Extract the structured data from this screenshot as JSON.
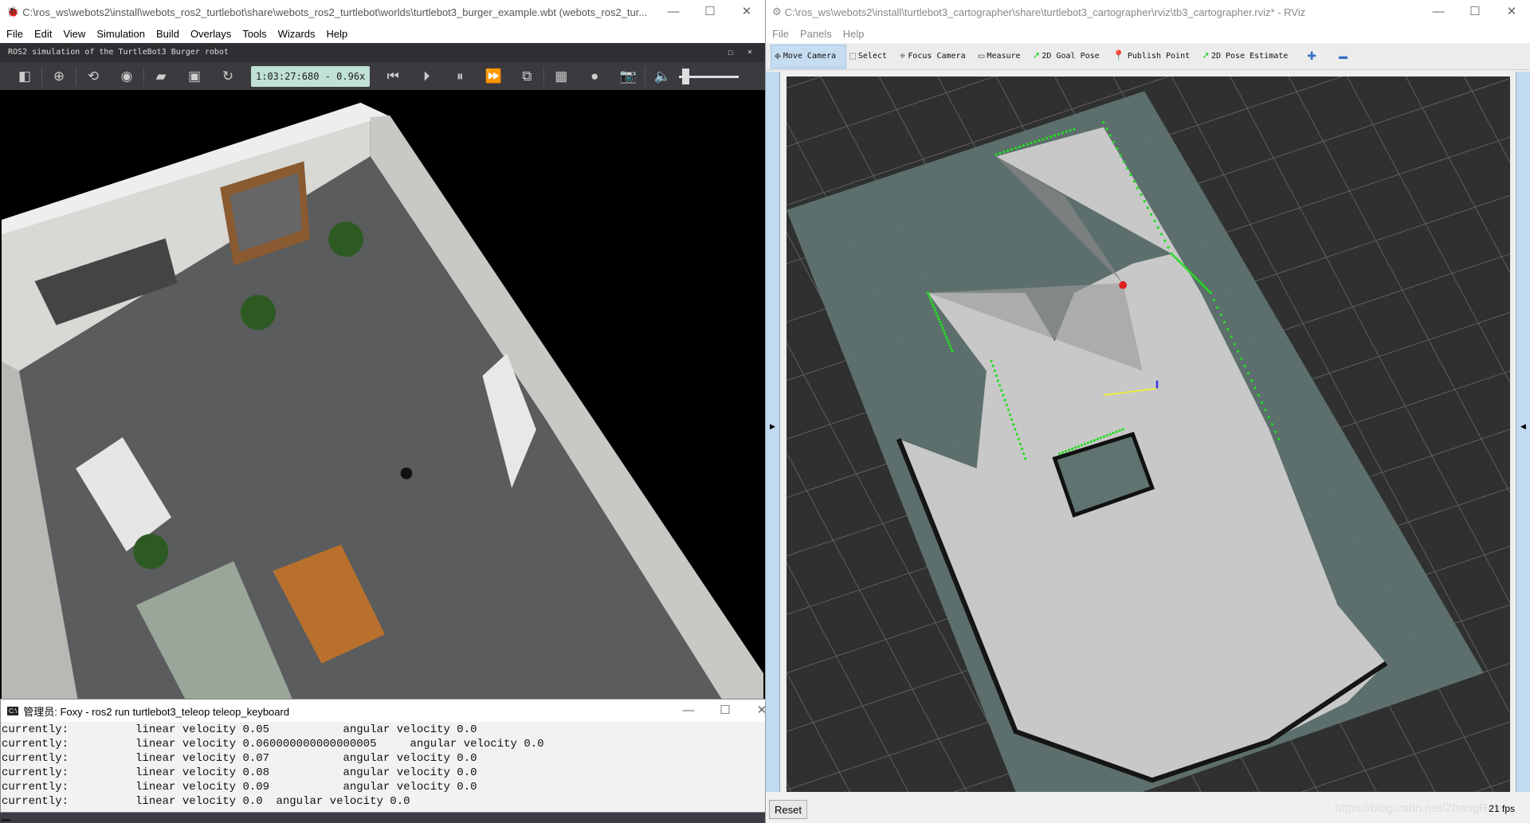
{
  "webots": {
    "title": "C:\\ros_ws\\webots2\\install\\webots_ros2_turtlebot\\share\\webots_ros2_turtlebot\\worlds\\turtlebot3_burger_example.wbt (webots_ros2_tur...",
    "menu": [
      "File",
      "Edit",
      "View",
      "Simulation",
      "Build",
      "Overlays",
      "Tools",
      "Wizards",
      "Help"
    ],
    "view_title": "ROS2 simulation of the TurtleBot3 Burger robot",
    "timer": "1:03:27:680  -  0.96x",
    "icons": [
      "toggle-scene-tree-icon",
      "add-node-icon",
      "reset-view-icon",
      "view-eye-icon",
      "open-folder-icon",
      "save-icon",
      "reload-icon",
      "step-back-icon",
      "step-icon",
      "pause-icon",
      "fast-forward-icon",
      "render-cube-icon",
      "movie-icon",
      "record-icon",
      "screenshot-icon",
      "mute-icon"
    ],
    "volume": 0.05
  },
  "terminal": {
    "title": "管理员: Foxy - ros2  run turtlebot3_teleop teleop_keyboard",
    "lines": [
      "currently:\tlinear velocity 0.05\t angular velocity 0.0",
      "currently:\tlinear velocity 0.060000000000000005\t angular velocity 0.0",
      "currently:\tlinear velocity 0.07\t angular velocity 0.0",
      "currently:\tlinear velocity 0.08\t angular velocity 0.0",
      "currently:\tlinear velocity 0.09\t angular velocity 0.0",
      "currently:\tlinear velocity 0.0\t angular velocity 0.0"
    ]
  },
  "rviz": {
    "title": "C:\\ros_ws\\webots2\\install\\turtlebot3_cartographer\\share\\turtlebot3_cartographer\\rviz\\tb3_cartographer.rviz* - RViz",
    "menu": [
      "File",
      "Panels",
      "Help"
    ],
    "tools": [
      {
        "label": "Move Camera",
        "icon": "move-camera-icon",
        "active": true
      },
      {
        "label": "Select",
        "icon": "select-icon"
      },
      {
        "label": "Focus Camera",
        "icon": "focus-camera-icon"
      },
      {
        "label": "Measure",
        "icon": "ruler-icon"
      },
      {
        "label": "2D Goal Pose",
        "icon": "green-arrow-icon"
      },
      {
        "label": "Publish Point",
        "icon": "map-pin-icon"
      },
      {
        "label": "2D Pose Estimate",
        "icon": "green-arrow-icon"
      }
    ],
    "reset_label": "Reset",
    "fps": "21 fps",
    "watermark": "https://blog.csdn.net/ZhangRelay",
    "colors": {
      "background": "#303030",
      "plane": "#5f7370",
      "map_free": "#c8c8c8",
      "scan": "#22dd22"
    }
  }
}
